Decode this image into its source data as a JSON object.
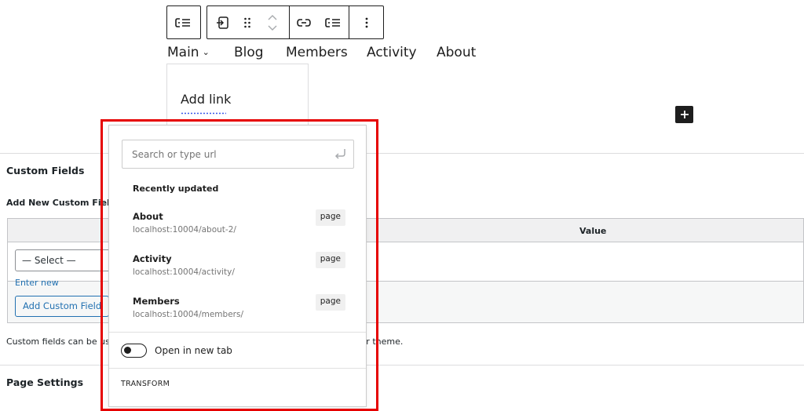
{
  "nav": {
    "items": [
      {
        "label": "Main",
        "has_submenu": true
      },
      {
        "label": "Blog"
      },
      {
        "label": "Members"
      },
      {
        "label": "Activity"
      },
      {
        "label": "About"
      }
    ],
    "submenu_add_link": "Add link"
  },
  "meta": {
    "custom_fields_title": "Custom Fields",
    "add_new_label": "Add New Custom Field:",
    "value_header": "Value",
    "select_placeholder": "— Select —",
    "enter_new": "Enter new",
    "add_button": "Add Custom Field",
    "note_text": "Custom fields can be used to add extra metadata to a post that you can use in your theme.",
    "page_settings_title": "Page Settings"
  },
  "link_popover": {
    "search_placeholder": "Search or type url",
    "recently_updated_label": "Recently updated",
    "results": [
      {
        "title": "About",
        "url": "localhost:10004/about-2/",
        "type": "page"
      },
      {
        "title": "Activity",
        "url": "localhost:10004/activity/",
        "type": "page"
      },
      {
        "title": "Members",
        "url": "localhost:10004/members/",
        "type": "page"
      }
    ],
    "open_new_tab_label": "Open in new tab",
    "open_new_tab_checked": false,
    "transform_label": "TRANSFORM"
  },
  "colors": {
    "highlight": "#e60000",
    "dark": "#1e1e1e",
    "link_blue": "#2271b1",
    "muted": "#757575"
  }
}
